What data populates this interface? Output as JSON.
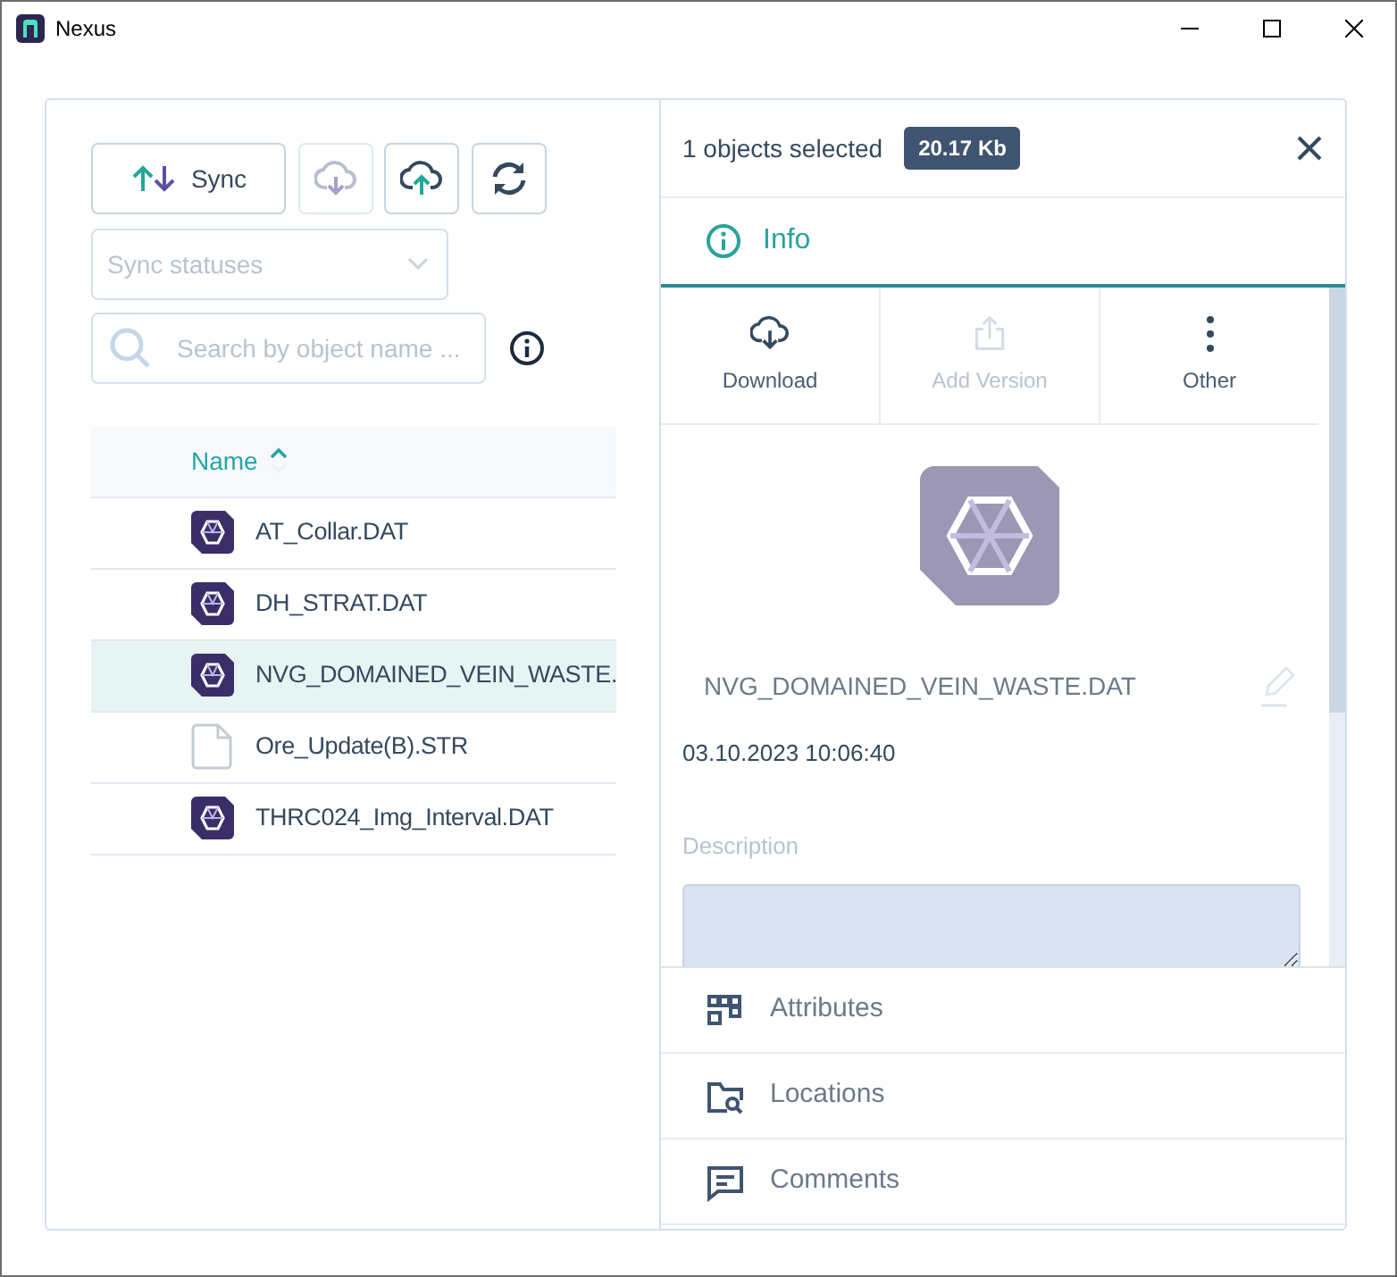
{
  "window": {
    "title": "Nexus"
  },
  "toolbar": {
    "sync_label": "Sync",
    "icon_buttons": [
      {
        "kind": "download",
        "disabled": true
      },
      {
        "kind": "upload",
        "disabled": false
      },
      {
        "kind": "refresh",
        "disabled": false
      }
    ]
  },
  "status_filter": {
    "placeholder": "Sync statuses"
  },
  "search": {
    "placeholder": "Search by object name ..."
  },
  "table": {
    "columns": [
      {
        "label": "Name",
        "sort_ascending": true
      }
    ],
    "rows": [
      {
        "name": "AT_Collar.DAT",
        "kind": "dat",
        "selected": false
      },
      {
        "name": "DH_STRAT.DAT",
        "kind": "dat",
        "selected": false
      },
      {
        "name": "NVG_DOMAINED_VEIN_WASTE.",
        "kind": "dat",
        "selected": true
      },
      {
        "name": "Ore_Update(B).STR",
        "kind": "file",
        "selected": false
      },
      {
        "name": "THRC024_Img_Interval.DAT",
        "kind": "dat",
        "selected": false
      }
    ]
  },
  "details": {
    "selection": "1 objects selected",
    "size": "20.17 Kb",
    "tabs": [
      {
        "label": "Info",
        "selected": true
      }
    ],
    "actions": [
      {
        "label": "Download",
        "kind": "download",
        "disabled": false
      },
      {
        "label": "Add Version",
        "kind": "share",
        "disabled": true
      },
      {
        "label": "Other",
        "kind": "more",
        "disabled": false
      }
    ],
    "file_name": "NVG_DOMAINED_VEIN_WASTE.DAT",
    "modified": "03.10.2023 10:06:40",
    "description_label": "Description",
    "sections": [
      {
        "label": "Attributes",
        "kind": "attributes"
      },
      {
        "label": "Locations",
        "kind": "locations"
      },
      {
        "label": "Comments",
        "kind": "comments"
      }
    ]
  }
}
